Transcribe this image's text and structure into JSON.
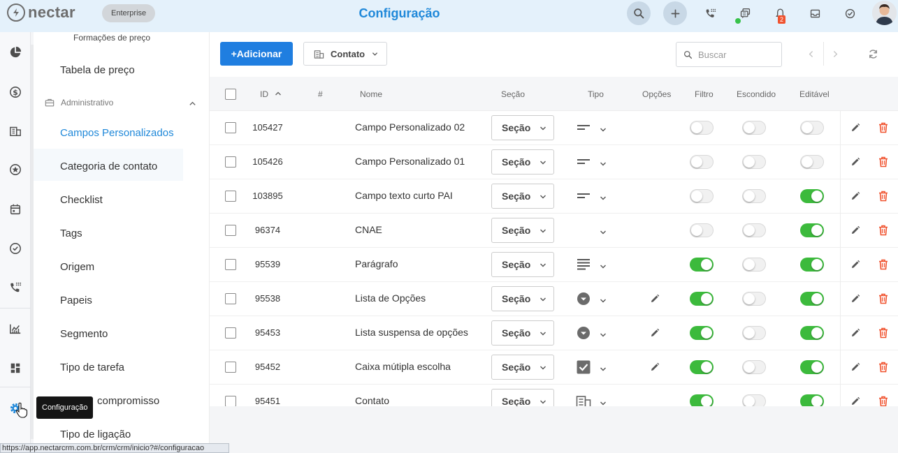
{
  "app": {
    "logo_text": "nectar",
    "plan_badge": "Enterprise",
    "page_title": "Configuração",
    "notification_count": "2"
  },
  "toolbar": {
    "add_label": "+Adicionar",
    "entity_label": "Contato",
    "search_placeholder": "Buscar"
  },
  "subnav": {
    "top_item": "Formações de preço",
    "item_tabela": "Tabela de preço",
    "group_label": "Administrativo",
    "items": [
      "Campos Personalizados",
      "Categoria de contato",
      "Checklist",
      "Tags",
      "Origem",
      "Papeis",
      "Segmento",
      "Tipo de tarefa",
      "compromisso",
      "Tipo de ligação"
    ]
  },
  "tooltip": "Configuração",
  "status_url": "https://app.nectarcrm.com.br/crm/crm/inicio?#/configuracao",
  "table": {
    "headers": {
      "id": "ID",
      "hash": "#",
      "nome": "Nome",
      "secao": "Seção",
      "tipo": "Tipo",
      "opcoes": "Opções",
      "filtro": "Filtro",
      "escondido": "Escondido",
      "editavel": "Editável"
    },
    "select_label": "Seção",
    "rows": [
      {
        "id": "105427",
        "name": "Campo Personalizado 02",
        "type_icon": "short-text-icon",
        "options_edit": false,
        "filtro": false,
        "escondido": false,
        "editavel": false
      },
      {
        "id": "105426",
        "name": "Campo Personalizado 01",
        "type_icon": "short-text-icon",
        "options_edit": false,
        "filtro": false,
        "escondido": false,
        "editavel": false
      },
      {
        "id": "103895",
        "name": "Campo texto curto PAI",
        "type_icon": "short-text-icon",
        "options_edit": false,
        "filtro": false,
        "escondido": false,
        "editavel": true
      },
      {
        "id": "96374",
        "name": "CNAE",
        "type_icon": "none",
        "options_edit": false,
        "filtro": false,
        "escondido": false,
        "editavel": true
      },
      {
        "id": "95539",
        "name": "Parágrafo",
        "type_icon": "paragraph-icon",
        "options_edit": false,
        "filtro": true,
        "escondido": false,
        "editavel": true
      },
      {
        "id": "95538",
        "name": "Lista de Opções",
        "type_icon": "dropdown-circle-icon",
        "options_edit": true,
        "filtro": true,
        "escondido": false,
        "editavel": true
      },
      {
        "id": "95453",
        "name": "Lista suspensa de opções",
        "type_icon": "dropdown-circle-icon",
        "options_edit": true,
        "filtro": true,
        "escondido": false,
        "editavel": true
      },
      {
        "id": "95452",
        "name": "Caixa mútipla escolha",
        "type_icon": "checkbox-icon",
        "options_edit": true,
        "filtro": true,
        "escondido": false,
        "editavel": true
      },
      {
        "id": "95451",
        "name": "Contato",
        "type_icon": "building-icon",
        "options_edit": false,
        "filtro": true,
        "escondido": false,
        "editavel": true
      }
    ]
  },
  "colors": {
    "accent": "#1f88d9",
    "primary_button": "#1f7ee0",
    "toggle_on": "#3cba3c",
    "delete": "#f0522e"
  }
}
